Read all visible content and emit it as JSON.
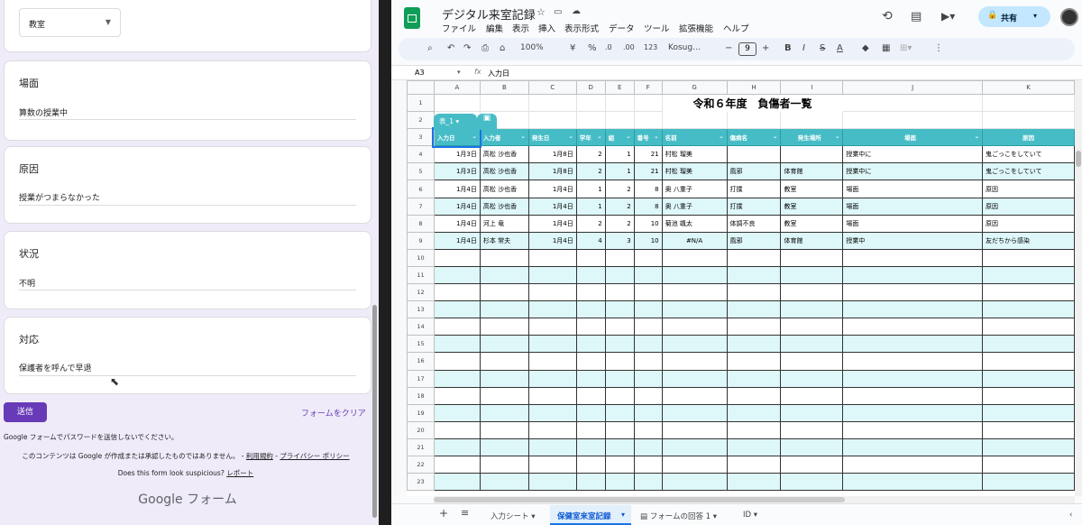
{
  "form": {
    "dropdown_value": "教室",
    "cards": [
      {
        "question": "場面",
        "answer": "算数の授業中"
      },
      {
        "question": "原因",
        "answer": "授業がつまらなかった"
      },
      {
        "question": "状況",
        "answer": "不明"
      },
      {
        "question": "対応",
        "answer": "保護者を呼んで早退"
      }
    ],
    "submit_label": "送信",
    "clear_label": "フォームをクリア",
    "password_notice": "Google フォームでパスワードを送信しないでください。",
    "disclaimer": "このコンテンツは Google が作成または承認したものではありません。",
    "terms_link": "利用規約",
    "privacy_link": "プライバシー ポリシー",
    "suspicious_text": "Does this form look suspicious?",
    "report_link": "レポート",
    "logo_text": "Google フォーム"
  },
  "sheet": {
    "title": "デジタル来室記録",
    "menus": [
      "ファイル",
      "編集",
      "表示",
      "挿入",
      "表示形式",
      "データ",
      "ツール",
      "拡張機能",
      "ヘルプ"
    ],
    "share_label": "共有",
    "zoom": "100%",
    "font": "Kosug…",
    "font_size": "9",
    "cell_ref": "A3",
    "formula": "入力日",
    "table_name": "表_1",
    "sheet_title": "令和６年度　負傷者一覧",
    "col_letters": [
      "A",
      "B",
      "C",
      "D",
      "E",
      "F",
      "G",
      "H",
      "I",
      "J",
      "K"
    ],
    "headers": [
      "入力日",
      "入力者",
      "発生日",
      "学年",
      "組",
      "番号",
      "名前",
      "傷病名",
      "発生場所",
      "場面",
      "原因"
    ],
    "rows": [
      [
        "1月3日",
        "高松 沙也香",
        "1月8日",
        "2",
        "1",
        "21",
        "村松 瑠美",
        "",
        "",
        "授業中に",
        "鬼ごっこをしていて"
      ],
      [
        "1月3日",
        "高松 沙也香",
        "1月8日",
        "2",
        "1",
        "21",
        "村松 瑠美",
        "風邪",
        "体育館",
        "授業中に",
        "鬼ごっこをしていて"
      ],
      [
        "1月4日",
        "高松 沙也香",
        "1月4日",
        "1",
        "2",
        "8",
        "奥 八重子",
        "打撲",
        "教室",
        "場面",
        "原因"
      ],
      [
        "1月4日",
        "高松 沙也香",
        "1月4日",
        "1",
        "2",
        "8",
        "奥 八重子",
        "打撲",
        "教室",
        "場面",
        "原因"
      ],
      [
        "1月4日",
        "河上 竜",
        "1月4日",
        "2",
        "2",
        "10",
        "菊池 颯太",
        "体調不良",
        "教室",
        "場面",
        "原因"
      ],
      [
        "1月4日",
        "杉本 常夫",
        "1月4日",
        "4",
        "3",
        "10",
        "#N/A",
        "風邪",
        "体育館",
        "授業中",
        "友だちから感染"
      ]
    ],
    "empty_rows": [
      "10",
      "11",
      "12",
      "13",
      "14",
      "15",
      "16",
      "17",
      "18",
      "19",
      "20",
      "21",
      "22",
      "23"
    ],
    "tabs": [
      "入力シート",
      "保健室来室記録",
      "フォームの回答 1",
      "ID"
    ]
  }
}
